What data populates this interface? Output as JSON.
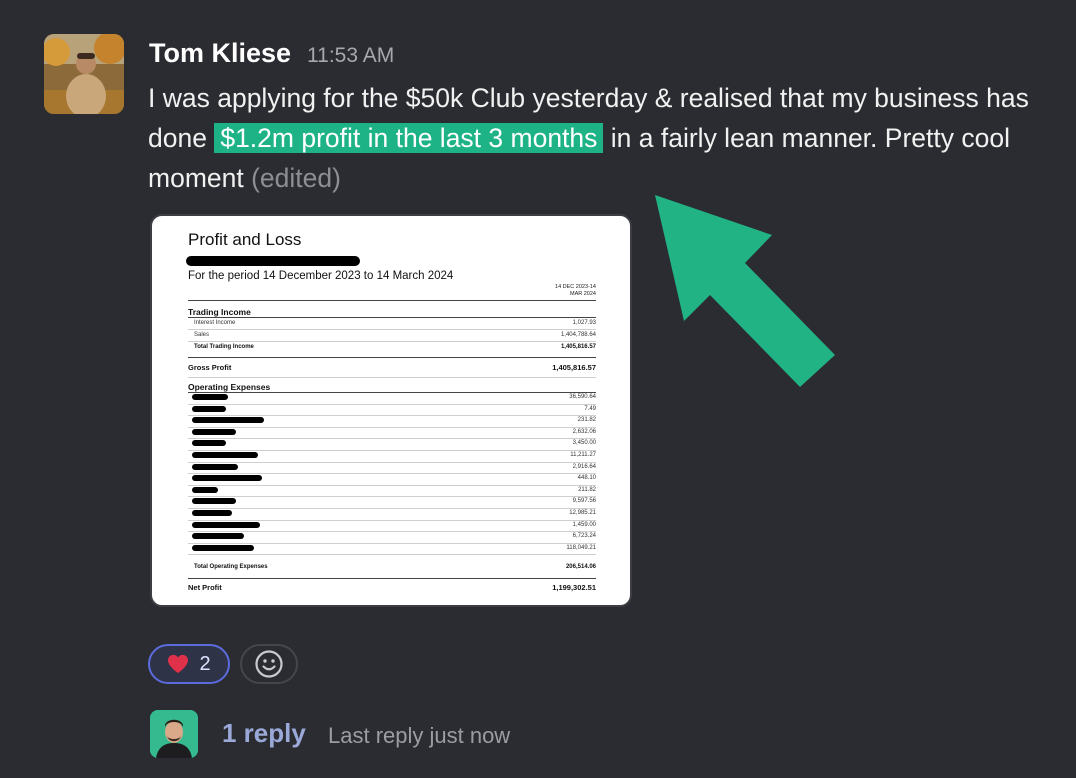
{
  "message": {
    "sender": "Tom Kliese",
    "time": "11:53 AM",
    "text_before": "I was applying for the $50k Club yesterday & realised that my business has done ",
    "highlight": "$1.2m profit in the last 3 months",
    "text_after": " in a fairly lean manner. Pretty cool moment ",
    "edited": "(edited)"
  },
  "attachment": {
    "title": "Profit and Loss",
    "period": "For the period 14 December 2023 to 14 March 2024",
    "column_header_line1": "14 DEC 2023-14",
    "column_header_line2": "MAR 2024",
    "trading_income_heading": "Trading Income",
    "interest_income_label": "Interest Income",
    "interest_income_value": "1,027.93",
    "sales_label": "Sales",
    "sales_value": "1,404,788.64",
    "total_trading_label": "Total Trading Income",
    "total_trading_value": "1,405,816.57",
    "gross_profit_label": "Gross Profit",
    "gross_profit_value": "1,405,816.57",
    "operating_expenses_heading": "Operating Expenses",
    "expense_values": [
      "36,590.64",
      "7.49",
      "231.82",
      "2,632.06",
      "3,450.00",
      "11,211.27",
      "2,916.64",
      "448.10",
      "211.82",
      "9,597.56",
      "12,985.21",
      "1,459.00",
      "6,723.24",
      "118,049.21"
    ],
    "total_opex_label": "Total Operating Expenses",
    "total_opex_value": "206,514.06",
    "net_profit_label": "Net Profit",
    "net_profit_value": "1,199,302.51"
  },
  "reactions": {
    "heart_count": "2"
  },
  "thread": {
    "reply_count": "1 reply",
    "last_reply": "Last reply just now"
  },
  "colors": {
    "background": "#2b2c31",
    "highlight": "#1eb386",
    "arrow": "#22b385",
    "reaction_border": "#5b6bdb",
    "reply_link": "#9aa9d8"
  },
  "icons": [
    "heart-icon",
    "add-reaction-icon",
    "arrow-icon"
  ]
}
